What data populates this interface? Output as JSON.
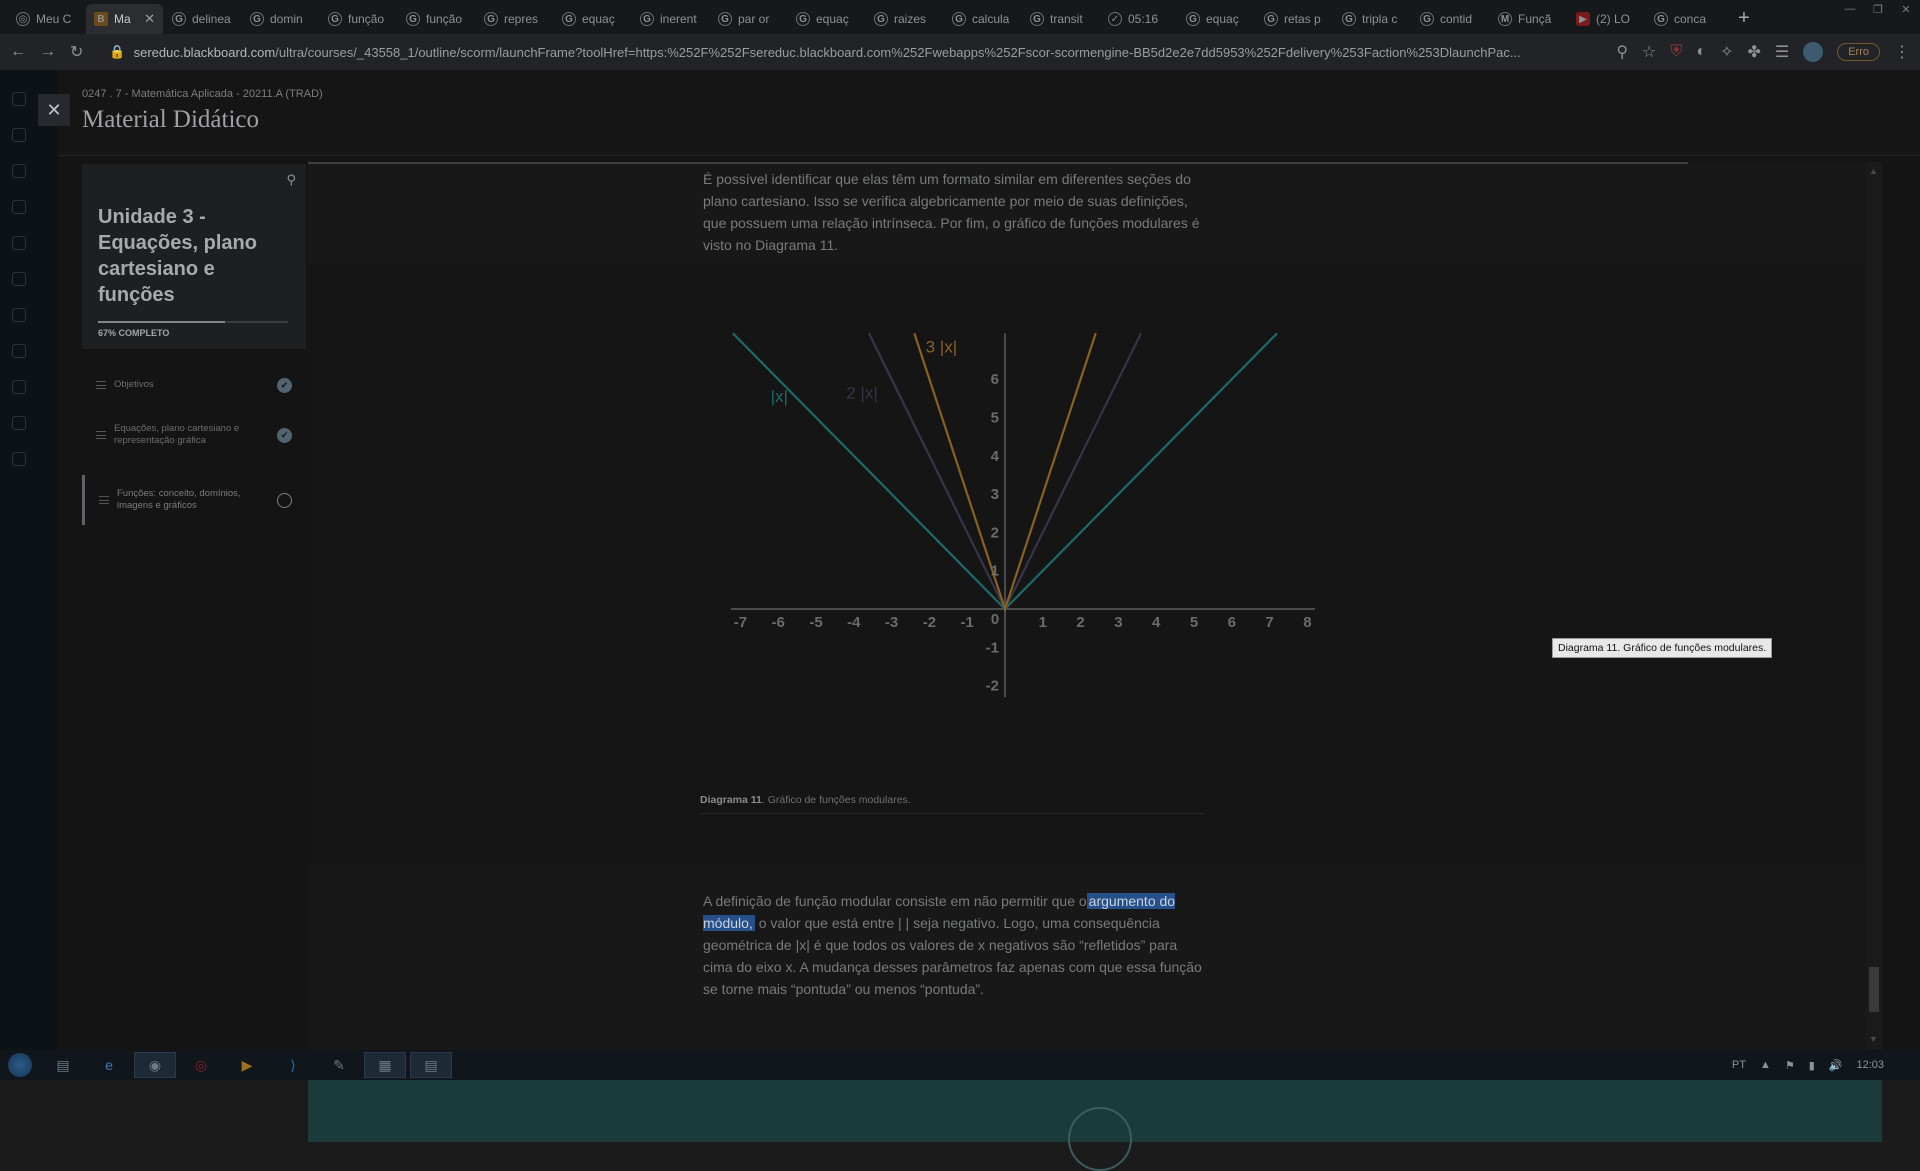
{
  "browser": {
    "tabs": [
      {
        "title": "Meu C",
        "icon": "chrome-icon"
      },
      {
        "title": "Ma",
        "icon": "blackboard-icon",
        "active": true
      },
      {
        "title": "delinea",
        "icon": "google-icon"
      },
      {
        "title": "domin",
        "icon": "google-icon"
      },
      {
        "title": "função",
        "icon": "google-icon"
      },
      {
        "title": "função",
        "icon": "google-icon"
      },
      {
        "title": "repres",
        "icon": "google-icon"
      },
      {
        "title": "equaç",
        "icon": "google-icon"
      },
      {
        "title": "inerent",
        "icon": "google-icon"
      },
      {
        "title": "par or",
        "icon": "google-icon"
      },
      {
        "title": "equaç",
        "icon": "google-icon"
      },
      {
        "title": "raizes",
        "icon": "google-icon"
      },
      {
        "title": "calcula",
        "icon": "google-icon"
      },
      {
        "title": "transit",
        "icon": "google-icon"
      },
      {
        "title": "05:16",
        "icon": "check-icon"
      },
      {
        "title": "equaç",
        "icon": "google-icon"
      },
      {
        "title": "retas p",
        "icon": "google-icon"
      },
      {
        "title": "tripla c",
        "icon": "google-icon"
      },
      {
        "title": "contid",
        "icon": "google-icon"
      },
      {
        "title": "Funçã",
        "icon": "m-icon"
      },
      {
        "title": "(2) LO",
        "icon": "youtube-icon"
      },
      {
        "title": "conca",
        "icon": "google-icon"
      }
    ],
    "url_host": "sereduc.blackboard.com",
    "url_path": "/ultra/courses/_43558_1/outline/scorm/launchFrame?toolHref=https:%252F%252Fsereduc.blackboard.com%252Fwebapps%252Fscor-scormengine-BB5d2e2e7dd5953%252Fdelivery%253Faction%253DlaunchPac...",
    "profile_status": "Erro"
  },
  "page": {
    "course": "0247 . 7 - Matemática Aplicada - 20211.A (TRAD)",
    "title": "Material Didático"
  },
  "unit": {
    "title": "Unidade 3 - Equações, plano cartesiano e funções",
    "progress_label": "67% COMPLETO",
    "progress": 0.67
  },
  "sidebar": {
    "items": [
      {
        "label": "Objetivos",
        "status": "complete"
      },
      {
        "label": "Equações, plano cartesiano e representação gráfica",
        "status": "complete"
      },
      {
        "label": "Funções: conceito, domínios, imagens e gráficos",
        "status": "in-progress"
      }
    ]
  },
  "content": {
    "para1": "É possível identificar que elas têm um formato similar em diferentes seções do plano cartesiano. Isso se verifica algebricamente por meio de suas definições, que possuem uma relação intrínseca. Por fim, o gráfico de funções modulares é visto no Diagrama 11.",
    "caption_bold": "Diagrama 11",
    "caption_rest": ". Gráfico de funções modulares.",
    "tooltip": "Diagrama 11. Gráfico de funções modulares.",
    "para2_before": "A definição de função modular consiste em não permitir que o",
    "para2_highlight": "argumento do módulo,",
    "para2_after": " o valor que está entre | | seja negativo. Logo, uma consequência geométrica de |x| é que todos os valores de x negativos são “refletidos” para cima do eixo x. A mudança desses parâmetros faz apenas com que essa função se torne mais “pontuda” ou menos “pontuda”."
  },
  "chart_data": {
    "type": "line",
    "x_ticks": [
      -7,
      -6,
      -5,
      -4,
      -3,
      -2,
      -1,
      0,
      1,
      2,
      3,
      4,
      5,
      6,
      7,
      8
    ],
    "y_ticks": [
      -2,
      -1,
      1,
      2,
      3,
      4,
      5,
      6
    ],
    "xlim": [
      -7.2,
      8.2
    ],
    "ylim": [
      -2.2,
      7.2
    ],
    "grid": false,
    "series": [
      {
        "name": "|x|",
        "k": 1,
        "color": "#1c6a6a"
      },
      {
        "name": "2 |x|",
        "k": 2,
        "color": "#35354a"
      },
      {
        "name": "3 |x|",
        "k": 3,
        "color": "#8a6220"
      }
    ]
  },
  "taskbar": {
    "language": "PT",
    "time": "12:03"
  }
}
